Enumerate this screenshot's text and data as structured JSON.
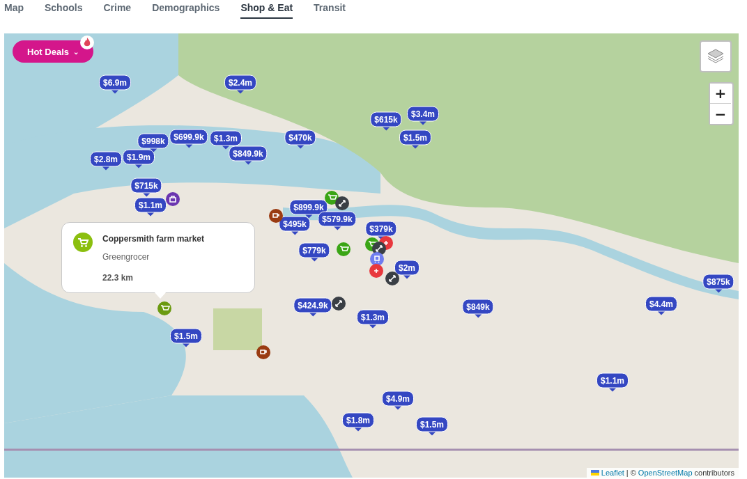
{
  "tabs": [
    {
      "label": "Map",
      "selected": false
    },
    {
      "label": "Schools",
      "selected": false
    },
    {
      "label": "Crime",
      "selected": false
    },
    {
      "label": "Demographics",
      "selected": false
    },
    {
      "label": "Shop & Eat",
      "selected": true
    },
    {
      "label": "Transit",
      "selected": false
    }
  ],
  "hot_deals": {
    "label": "Hot Deals",
    "caret": "⌄"
  },
  "zoom": {
    "in": "+",
    "out": "−"
  },
  "price_markers": [
    "$6.9m",
    "$2.4m",
    "$2.8m",
    "$1.9m",
    "$998k",
    "$699.9k",
    "$1.3m",
    "$849.9k",
    "$470k",
    "$615k",
    "$3.4m",
    "$1.5m",
    "$715k",
    "$1.1m",
    "$899.9k",
    "$495k",
    "$579.9k",
    "$379k",
    "$779k",
    "$2m",
    "$424.9k",
    "$1.3m",
    "$849k",
    "$875k",
    "$4.4m",
    "$1.5m",
    "$4.9m",
    "$1.8m",
    "$1.1m",
    "$1.5m"
  ],
  "popup": {
    "title": "Coppersmith farm market",
    "category": "Greengrocer",
    "distance": "22.3 km"
  },
  "attribution": {
    "leaflet": "Leaflet",
    "separator": "| ©",
    "osm": "OpenStreetMap",
    "suffix": "contributors"
  }
}
